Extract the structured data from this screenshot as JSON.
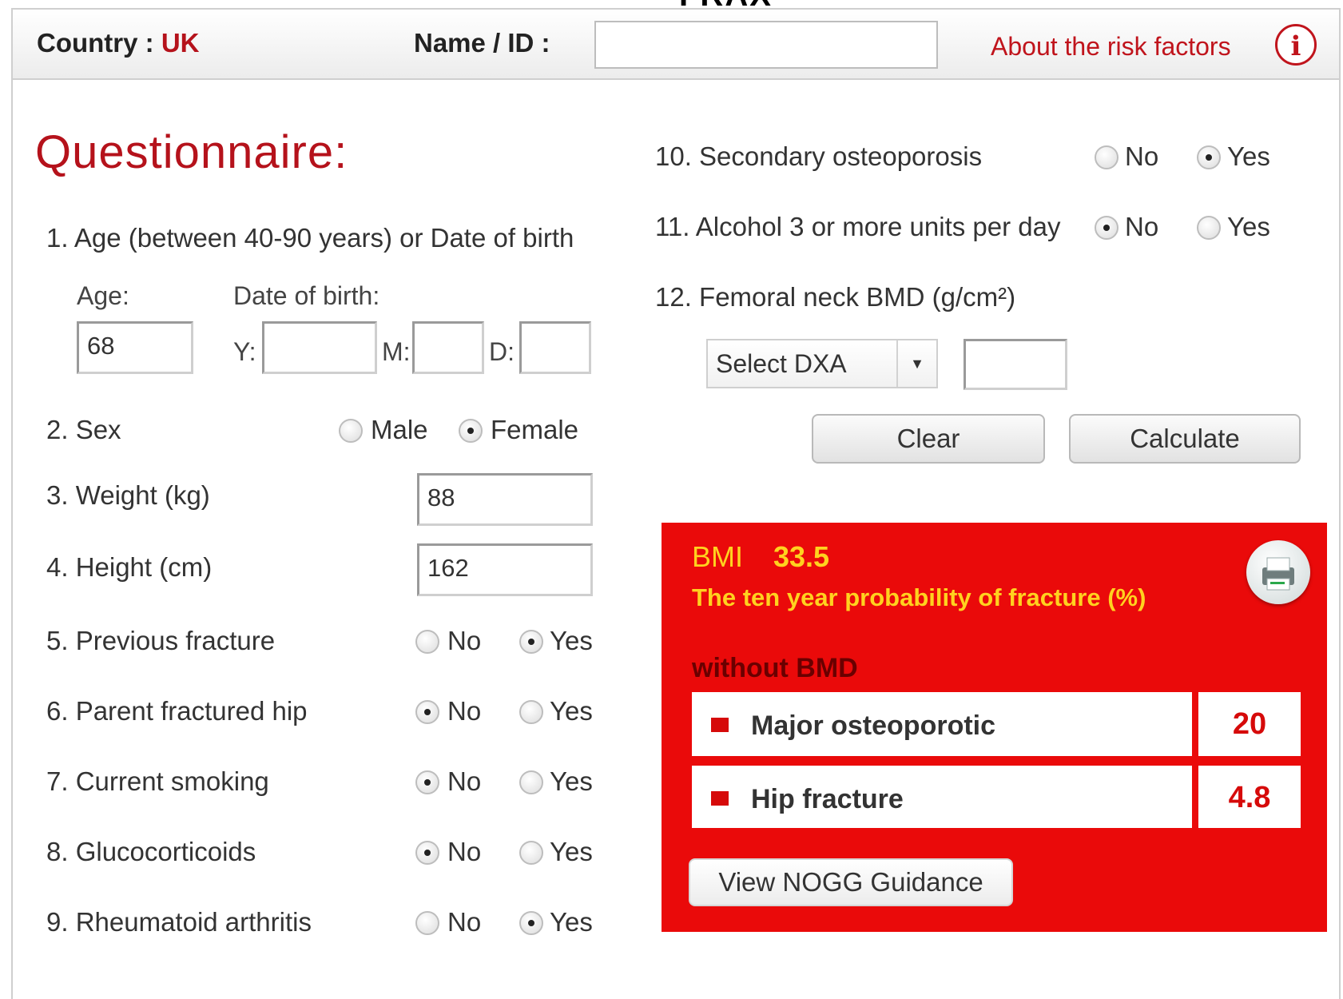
{
  "page": {
    "top_title": "FRAX"
  },
  "header": {
    "country_label": "Country :",
    "country_value": "UK",
    "name_label": "Name / ID :",
    "name_value": "",
    "about_link": "About the risk factors",
    "info_icon": "i"
  },
  "questionnaire": {
    "title": "Questionnaire:",
    "q1": {
      "label": "1. Age (between 40-90 years) or Date of birth",
      "age_label": "Age:",
      "age_value": "68",
      "dob_label": "Date of birth:",
      "y_label": "Y:",
      "m_label": "M:",
      "d_label": "D:",
      "y_value": "",
      "m_value": "",
      "d_value": ""
    },
    "q2": {
      "label": "2. Sex",
      "opt1": "Male",
      "opt2": "Female",
      "selected": "Female"
    },
    "q3": {
      "label": "3. Weight (kg)",
      "value": "88"
    },
    "q4": {
      "label": "4. Height (cm)",
      "value": "162"
    },
    "q5": {
      "label": "5. Previous fracture",
      "no": "No",
      "yes": "Yes",
      "selected": "Yes"
    },
    "q6": {
      "label": "6. Parent fractured hip",
      "no": "No",
      "yes": "Yes",
      "selected": "No"
    },
    "q7": {
      "label": "7. Current smoking",
      "no": "No",
      "yes": "Yes",
      "selected": "No"
    },
    "q8": {
      "label": "8. Glucocorticoids",
      "no": "No",
      "yes": "Yes",
      "selected": "No"
    },
    "q9": {
      "label": "9. Rheumatoid arthritis",
      "no": "No",
      "yes": "Yes",
      "selected": "Yes"
    },
    "q10": {
      "label": "10. Secondary osteoporosis",
      "no": "No",
      "yes": "Yes",
      "selected": "Yes"
    },
    "q11": {
      "label": "11. Alcohol 3 or more units per day",
      "no": "No",
      "yes": "Yes",
      "selected": "No"
    },
    "q12": {
      "label": "12. Femoral neck BMD  (g/cm²)",
      "select_value": "Select DXA",
      "bmd_value": ""
    }
  },
  "buttons": {
    "clear": "Clear",
    "calculate": "Calculate"
  },
  "result": {
    "bmi_label": "BMI",
    "bmi_value": "33.5",
    "title": "The ten year probability of fracture (%)",
    "section": "without BMD",
    "rows": [
      {
        "label": "Major osteoporotic",
        "value": "20"
      },
      {
        "label": "Hip fracture",
        "value": "4.8"
      }
    ],
    "nogg_button": "View NOGG Guidance",
    "colors": {
      "panel": "#ea0a0a",
      "highlight": "#ffd21f",
      "value": "#d60a0a"
    },
    "print_icon": "printer-icon"
  }
}
